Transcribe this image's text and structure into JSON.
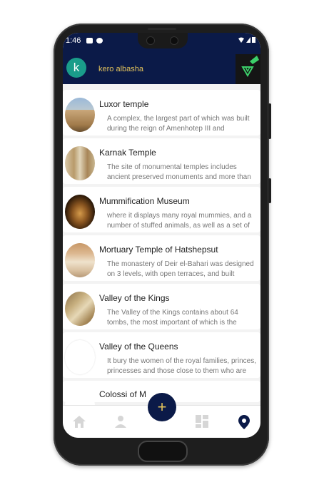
{
  "status_bar": {
    "time": "1:46"
  },
  "header": {
    "avatar_letter": "k",
    "username": "kero albasha"
  },
  "places": [
    {
      "title": "Luxor temple",
      "description": "A complex, the largest part of which was built during the reign of Amenhotep III and Ramesses"
    },
    {
      "title": "Karnak Temple",
      "description": "The site of monumental temples includes ancient preserved monuments and more than"
    },
    {
      "title": "Mummification Museum",
      "description": "where it displays many royal mummies, and a number of stuffed animals, as well as a set of"
    },
    {
      "title": "Mortuary Temple of Hatshepsut",
      "description": "The monastery of Deir el-Bahari was designed on 3 levels, with open terraces, and built entirely"
    },
    {
      "title": "Valley of the Kings",
      "description": "The Valley of the Kings contains about 64 tombs, the most important of which is the"
    },
    {
      "title": "Valley of the Queens",
      "description": "It bury the women of the royal families, princes, princesses and those close to them who are"
    }
  ],
  "partial_item": "Colossi of M",
  "fab": {
    "label": "+"
  },
  "colors": {
    "header_bg": "#0b1a48",
    "accent": "#e3c35b",
    "avatar_bg": "#1a9d8a"
  },
  "bottom_nav": {
    "icons": [
      "home-icon",
      "person-icon",
      "dashboard-icon",
      "location-pin-icon"
    ],
    "active": "location-pin-icon"
  }
}
